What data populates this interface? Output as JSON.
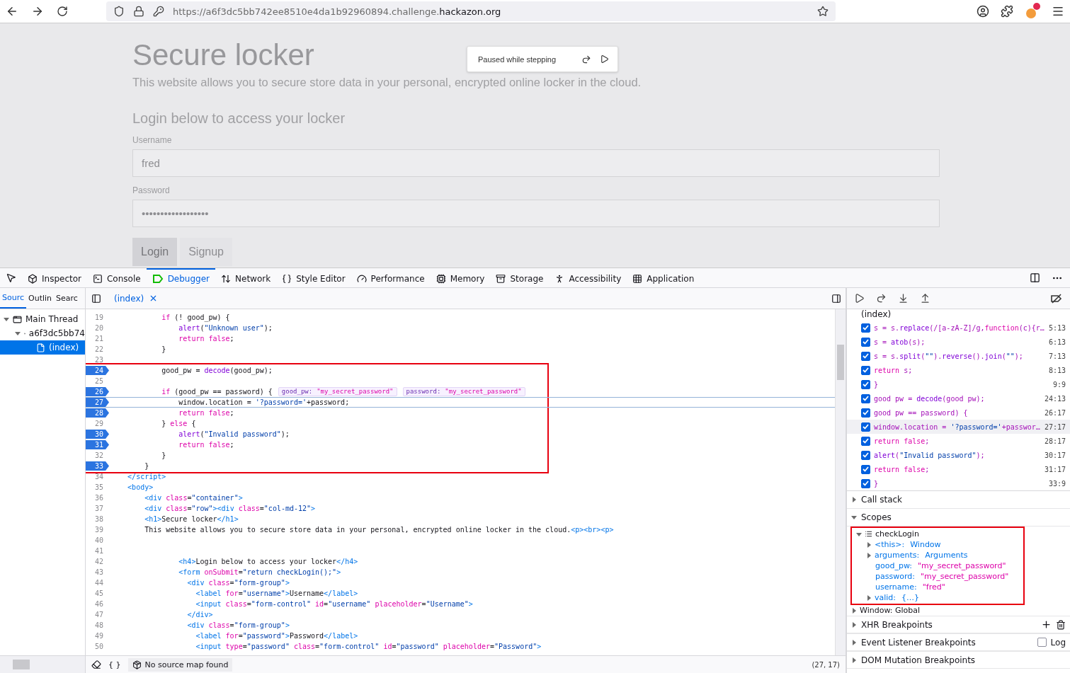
{
  "browser": {
    "url": "https://a6f3dc5bb742ee8510e4da1b92960894.challenge.**hackazon.org**"
  },
  "page": {
    "title": "Secure locker",
    "intro": "This website allows you to secure store data in your personal, encrypted online locker in the cloud.",
    "login_heading": "Login below to access your locker",
    "fields": [
      {
        "label": "Username",
        "value": "fred"
      },
      {
        "label": "Password",
        "value": "••••••••••••••••••"
      }
    ],
    "buttons": [
      {
        "label": "Login",
        "selected": true
      },
      {
        "label": "Signup",
        "selected": false
      }
    ],
    "pause_overlay": {
      "message": "Paused while stepping"
    }
  },
  "devtools": {
    "tabs": [
      {
        "label": "Inspector",
        "kind": "inspector",
        "selected": false
      },
      {
        "label": "Console",
        "kind": "console",
        "selected": false
      },
      {
        "label": "Debugger",
        "kind": "debugger",
        "selected": true
      },
      {
        "label": "Network",
        "kind": "network",
        "selected": false
      },
      {
        "label": "Style Editor",
        "kind": "style",
        "selected": false
      },
      {
        "label": "Performance",
        "kind": "performance",
        "selected": false
      },
      {
        "label": "Memory",
        "kind": "memory",
        "selected": false
      },
      {
        "label": "Storage",
        "kind": "storage",
        "selected": false
      },
      {
        "label": "Accessibility",
        "kind": "accessibility",
        "selected": false
      },
      {
        "label": "Application",
        "kind": "application",
        "selected": false
      }
    ],
    "source_tabs": [
      {
        "label": "Sourc",
        "selected": true
      },
      {
        "label": "Outlin",
        "selected": false
      },
      {
        "label": "Searc",
        "selected": false
      }
    ],
    "source_tree": [
      {
        "label": "Main Thread",
        "kind": "thread",
        "expanded": true,
        "selected": false,
        "children": [
          {
            "label": "a6f3dc5bb74",
            "kind": "domain",
            "expanded": true,
            "selected": false,
            "children": [
              {
                "label": "(index)",
                "kind": "file",
                "selected": true
              }
            ]
          }
        ]
      }
    ],
    "editor_tab": {
      "label": "(index)"
    },
    "code_blocks": [
      {
        "boxed": false,
        "lines": [
          {
            "number": "19",
            "text": "            if (! good_pw) {",
            "breakpoint": false,
            "current": false
          },
          {
            "number": "20",
            "text": "                alert(\"Unknown user\");",
            "breakpoint": false,
            "current": false
          },
          {
            "number": "21",
            "text": "                return false;",
            "breakpoint": false,
            "current": false
          },
          {
            "number": "22",
            "text": "            }",
            "breakpoint": false,
            "current": false
          },
          {
            "number": "23",
            "breakpoint": false,
            "current": false
          }
        ]
      },
      {
        "boxed": true,
        "lines": [
          {
            "number": "24",
            "text": "            good_pw = decode(good_pw);",
            "breakpoint": true,
            "current": false
          },
          {
            "number": "25",
            "breakpoint": false,
            "current": false
          },
          {
            "number": "26",
            "text": "            if (good_pw == password) {",
            "breakpoint": true,
            "current": false,
            "previews": [
              {
                "name": "good_pw:",
                "value": "\"my_secret_password\""
              },
              {
                "name": "password:",
                "value": "\"my_secret_password\""
              }
            ]
          },
          {
            "number": "27",
            "text": "                window.location = '?password='+password;",
            "breakpoint": true,
            "current": true
          },
          {
            "number": "28",
            "text": "                return false;",
            "breakpoint": true,
            "current": false
          },
          {
            "number": "29",
            "text": "            } else {",
            "breakpoint": false,
            "current": false
          },
          {
            "number": "30",
            "text": "                alert(\"Invalid password\");",
            "breakpoint": true,
            "current": false
          },
          {
            "number": "31",
            "text": "                return false;",
            "breakpoint": true,
            "current": false
          },
          {
            "number": "32",
            "text": "            }",
            "breakpoint": false,
            "current": false
          },
          {
            "number": "33",
            "text": "        }",
            "breakpoint": true,
            "current": false
          }
        ]
      },
      {
        "boxed": false,
        "lines": [
          {
            "number": "34",
            "text": "    </script>",
            "breakpoint": false,
            "current": false
          },
          {
            "number": "35",
            "text": "    <body>",
            "breakpoint": false,
            "current": false
          },
          {
            "number": "36",
            "text": "        <div class=\"container\">",
            "breakpoint": false,
            "current": false
          },
          {
            "number": "37",
            "text": "        <div class=\"row\"><div class=\"col-md-12\">",
            "breakpoint": false,
            "current": false
          },
          {
            "number": "38",
            "text": "        <h1>Secure locker</h1>",
            "breakpoint": false,
            "current": false
          },
          {
            "number": "39",
            "text": "        This website allows you to secure store data in your personal, encrypted online locker in the cloud.<p><br><p>",
            "breakpoint": false,
            "current": false
          },
          {
            "number": "40",
            "breakpoint": false,
            "current": false
          },
          {
            "number": "41",
            "breakpoint": false,
            "current": false
          },
          {
            "number": "42",
            "text": "                <h4>Login below to access your locker</h4>",
            "breakpoint": false,
            "current": false
          },
          {
            "number": "43",
            "text": "                <form onSubmit=\"return checkLogin();\">",
            "breakpoint": false,
            "current": false
          },
          {
            "number": "44",
            "text": "                  <div class=\"form-group\">",
            "breakpoint": false,
            "current": false
          },
          {
            "number": "45",
            "text": "                    <label for=\"username\">Username</label>",
            "breakpoint": false,
            "current": false
          },
          {
            "number": "46",
            "text": "                    <input class=\"form-control\" id=\"username\" placeholder=\"Username\">",
            "breakpoint": false,
            "current": false
          },
          {
            "number": "47",
            "text": "                  </div>",
            "breakpoint": false,
            "current": false
          },
          {
            "number": "48",
            "text": "                  <div class=\"form-group\">",
            "breakpoint": false,
            "current": false
          },
          {
            "number": "49",
            "text": "                    <label for=\"password\">Password</label>",
            "breakpoint": false,
            "current": false
          },
          {
            "number": "50",
            "text": "                    <input type=\"password\" class=\"form-control\" id=\"password\" placeholder=\"Password\">",
            "breakpoint": false,
            "current": false
          }
        ]
      }
    ],
    "status_bar": {
      "format": "{ }",
      "source_map": "No source map found",
      "position": "(27, 17)"
    },
    "breakpoints": {
      "file": "(index)",
      "items": [
        {
          "text": "s = s.replace(/[a-zA-Z]/g,function(c){r…",
          "location": "5:13",
          "checked": true,
          "current": false
        },
        {
          "text": "s = atob(s);",
          "location": "6:13",
          "checked": true,
          "current": false
        },
        {
          "text": "s = s.split(\"\").reverse().join(\"\");",
          "location": "7:13",
          "checked": true,
          "current": false
        },
        {
          "text": "return s;",
          "location": "8:13",
          "checked": true,
          "current": false
        },
        {
          "text": "}",
          "location": "9:9",
          "checked": true,
          "current": false
        },
        {
          "text": "good_pw = decode(good_pw);",
          "location": "24:13",
          "checked": true,
          "current": false
        },
        {
          "text": "good_pw == password) {",
          "location": "26:17",
          "checked": true,
          "current": false
        },
        {
          "text": "window.location = '?password='+passwor…",
          "location": "27:17",
          "checked": true,
          "current": true
        },
        {
          "text": "return false;",
          "location": "28:17",
          "checked": true,
          "current": false
        },
        {
          "text": "alert(\"Invalid password\");",
          "location": "30:17",
          "checked": true,
          "current": false
        },
        {
          "text": "return false;",
          "location": "31:17",
          "checked": true,
          "current": false
        },
        {
          "text": "}",
          "location": "33:9",
          "checked": true,
          "current": false
        }
      ]
    },
    "call_stack": {
      "title": "Call stack",
      "expanded": false
    },
    "scopes": {
      "title": "Scopes",
      "expanded": true,
      "tree": [
        {
          "label": "checkLogin",
          "expanded": true,
          "boxed": true,
          "children": [
            {
              "name": "<this>:",
              "value": "Window",
              "kind": "object",
              "expandable": true
            },
            {
              "name": "arguments:",
              "value": "Arguments",
              "kind": "object",
              "expandable": true
            },
            {
              "name": "good_pw:",
              "value": "\"my_secret_password\"",
              "kind": "string",
              "expandable": false
            },
            {
              "name": "password:",
              "value": "\"my_secret_password\"",
              "kind": "string",
              "expandable": false
            },
            {
              "name": "username:",
              "value": "\"fred\"",
              "kind": "string",
              "expandable": false
            },
            {
              "name": "valid:",
              "value": "{…}",
              "kind": "object",
              "expandable": true
            }
          ]
        },
        {
          "label": "Window: Global",
          "expanded": false,
          "boxed": false
        }
      ]
    },
    "panels": [
      {
        "title": "XHR Breakpoints",
        "kind": "xhr",
        "expanded": false
      },
      {
        "title": "Event Listener Breakpoints",
        "kind": "events",
        "expanded": false,
        "log_label": "Log",
        "log_checked": false
      },
      {
        "title": "DOM Mutation Breakpoints",
        "kind": "dom",
        "expanded": false
      }
    ]
  }
}
